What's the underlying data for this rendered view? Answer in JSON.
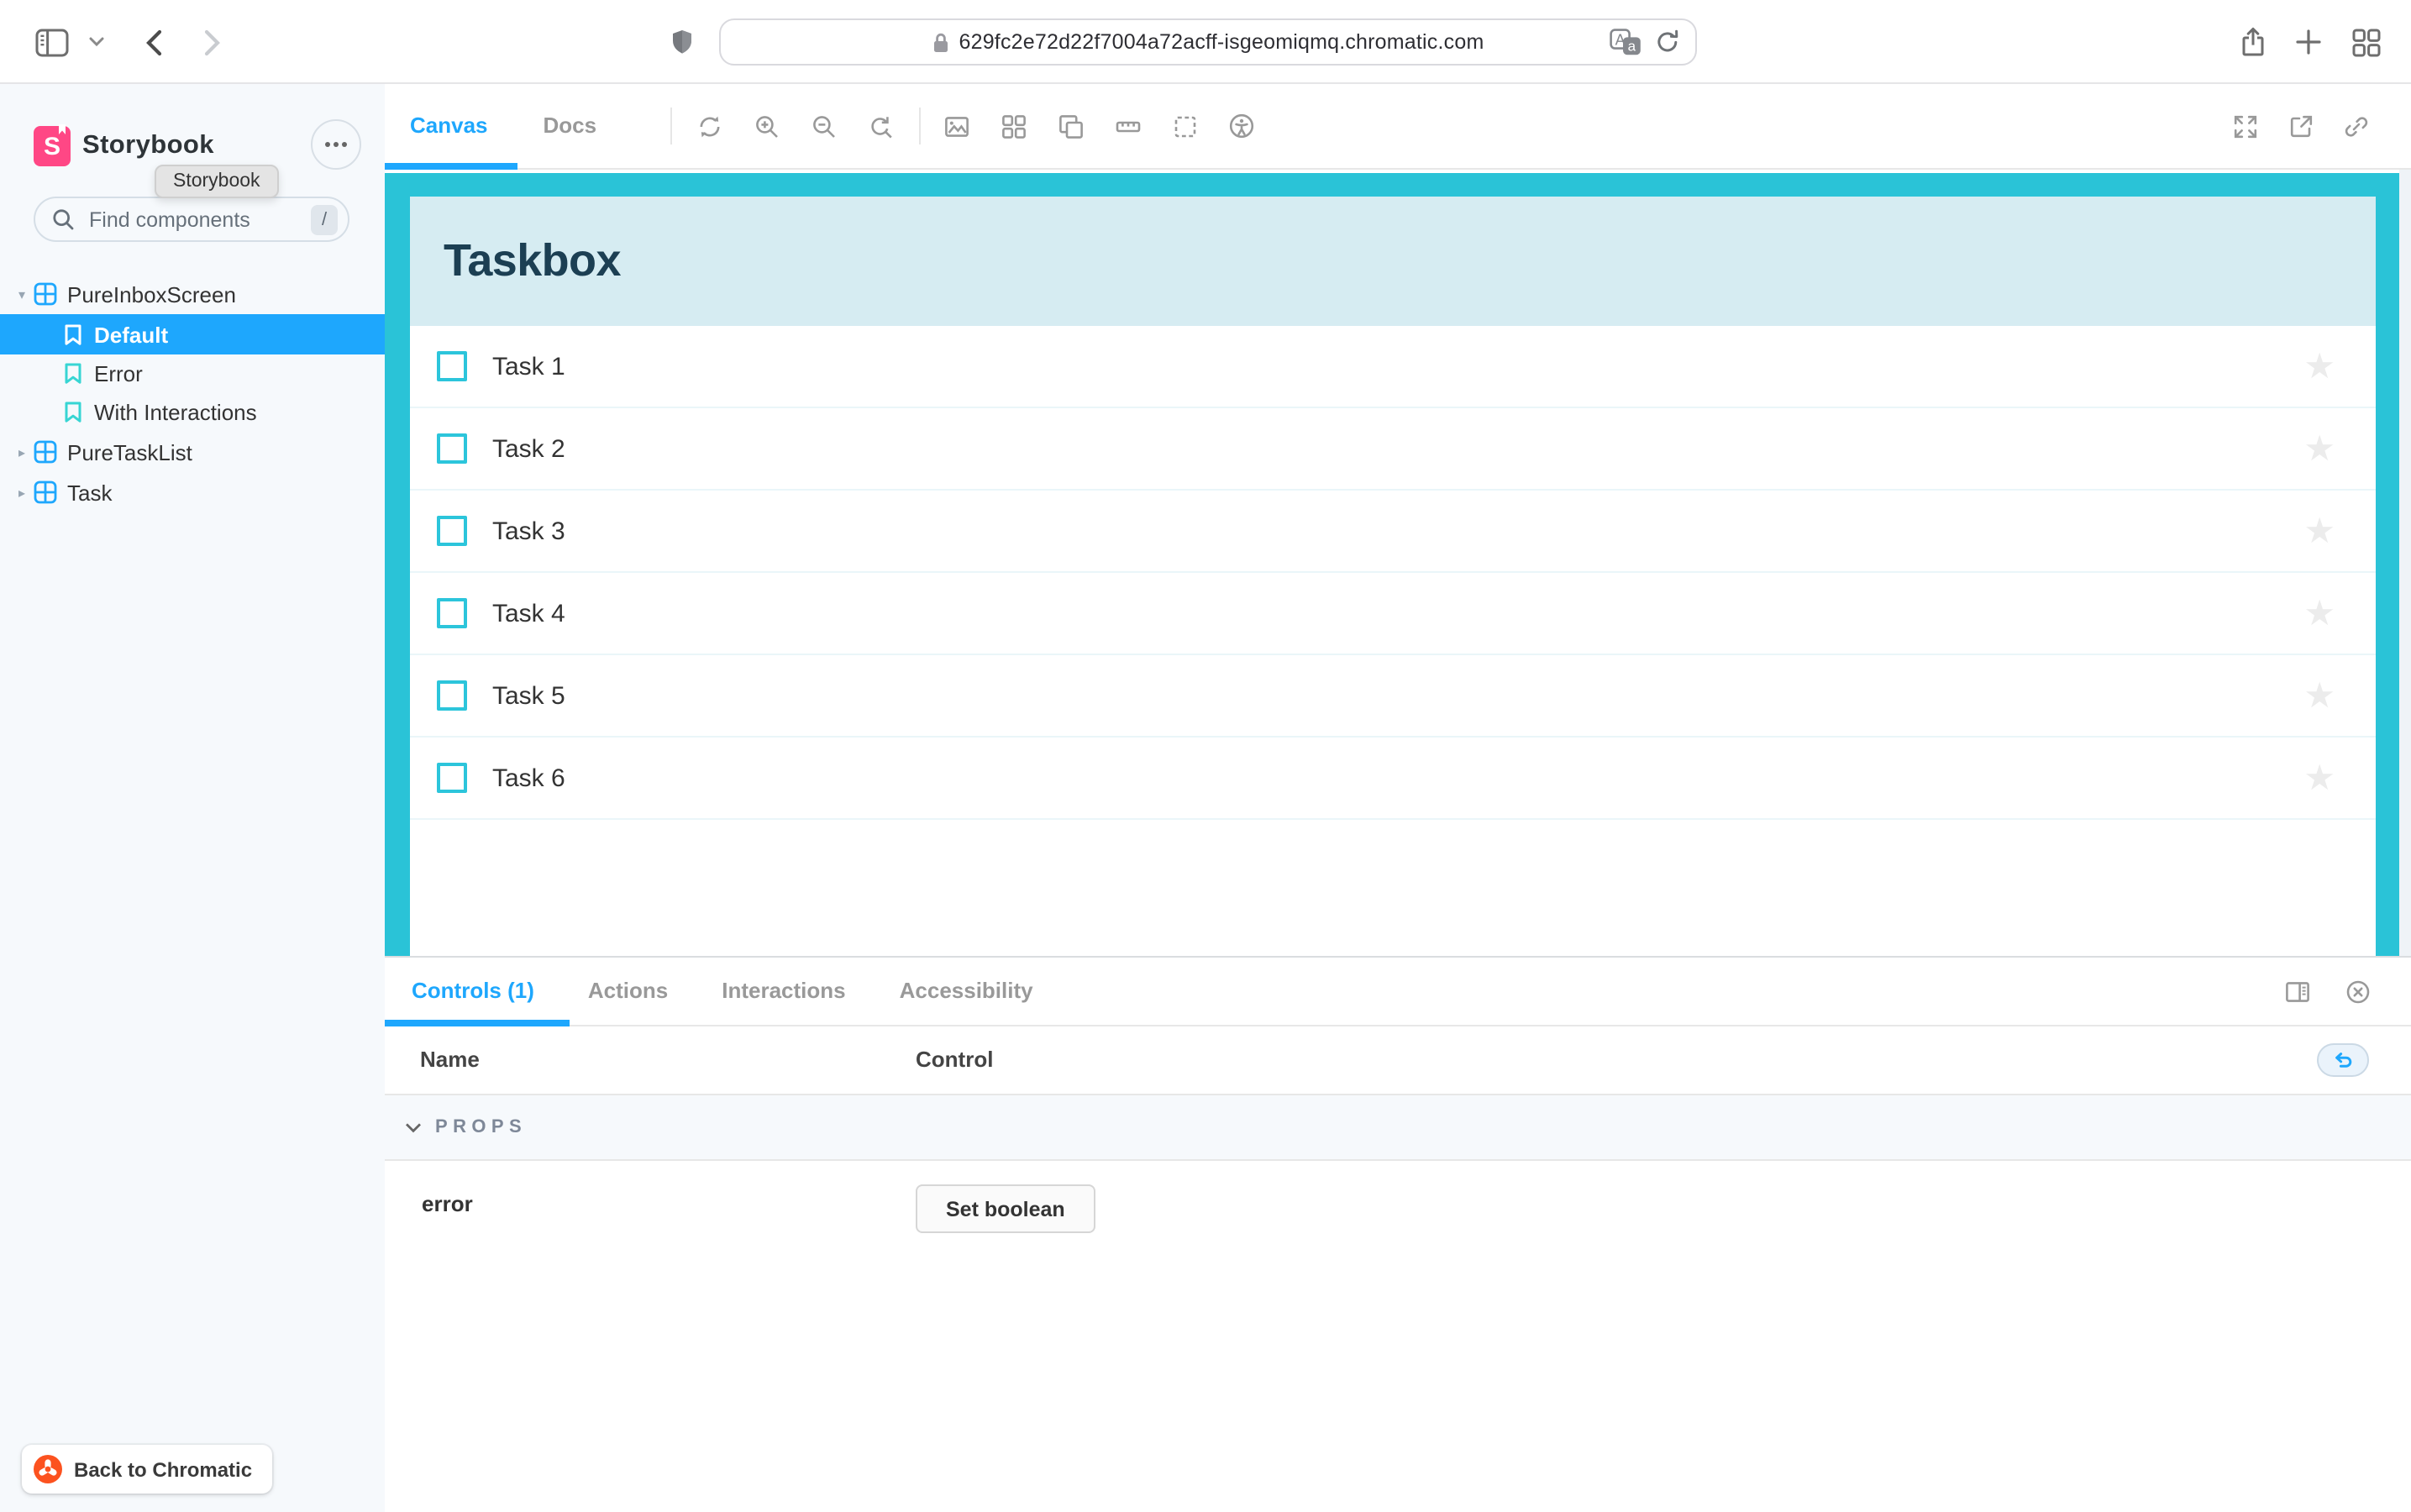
{
  "browser": {
    "url": "629fc2e72d22f7004a72acff-isgeomiqmq.chromatic.com"
  },
  "sidebar": {
    "brand": "Storybook",
    "tooltip": "Storybook",
    "search": {
      "placeholder": "Find components",
      "shortcut_key": "/"
    },
    "tree": [
      {
        "label": "PureInboxScreen",
        "type": "component",
        "expanded": true,
        "children": [
          {
            "label": "Default",
            "selected": true
          },
          {
            "label": "Error",
            "selected": false
          },
          {
            "label": "With Interactions",
            "selected": false
          }
        ]
      },
      {
        "label": "PureTaskList",
        "type": "component",
        "expanded": false
      },
      {
        "label": "Task",
        "type": "component",
        "expanded": false
      }
    ],
    "back_button_label": "Back to Chromatic"
  },
  "toolbar": {
    "tab_canvas": "Canvas",
    "tab_docs": "Docs",
    "icons": [
      "remount-icon",
      "zoom-in-icon",
      "zoom-out-icon",
      "zoom-reset-icon",
      "background-icon",
      "grid-icon",
      "viewport-icon",
      "measure-icon",
      "outline-icon",
      "accessibility-icon"
    ],
    "right_icons": [
      "fullscreen-icon",
      "open-external-icon",
      "copy-link-icon"
    ]
  },
  "preview": {
    "title": "Taskbox",
    "tasks": [
      "Task 1",
      "Task 2",
      "Task 3",
      "Task 4",
      "Task 5",
      "Task 6"
    ]
  },
  "panel": {
    "tabs": [
      "Controls (1)",
      "Actions",
      "Interactions",
      "Accessibility"
    ],
    "columns": {
      "name": "Name",
      "control": "Control"
    },
    "section_label": "PROPS",
    "rows": [
      {
        "name": "error",
        "control_label": "Set boolean"
      }
    ]
  },
  "colors": {
    "accent_blue": "#1EA7FD",
    "frame_cyan": "#2AC3D7",
    "header_blue": "#D6ECF2",
    "brand_pink": "#FF4785",
    "chromatic_orange": "#FC521F",
    "teal_bookmark": "#37D5D3"
  }
}
